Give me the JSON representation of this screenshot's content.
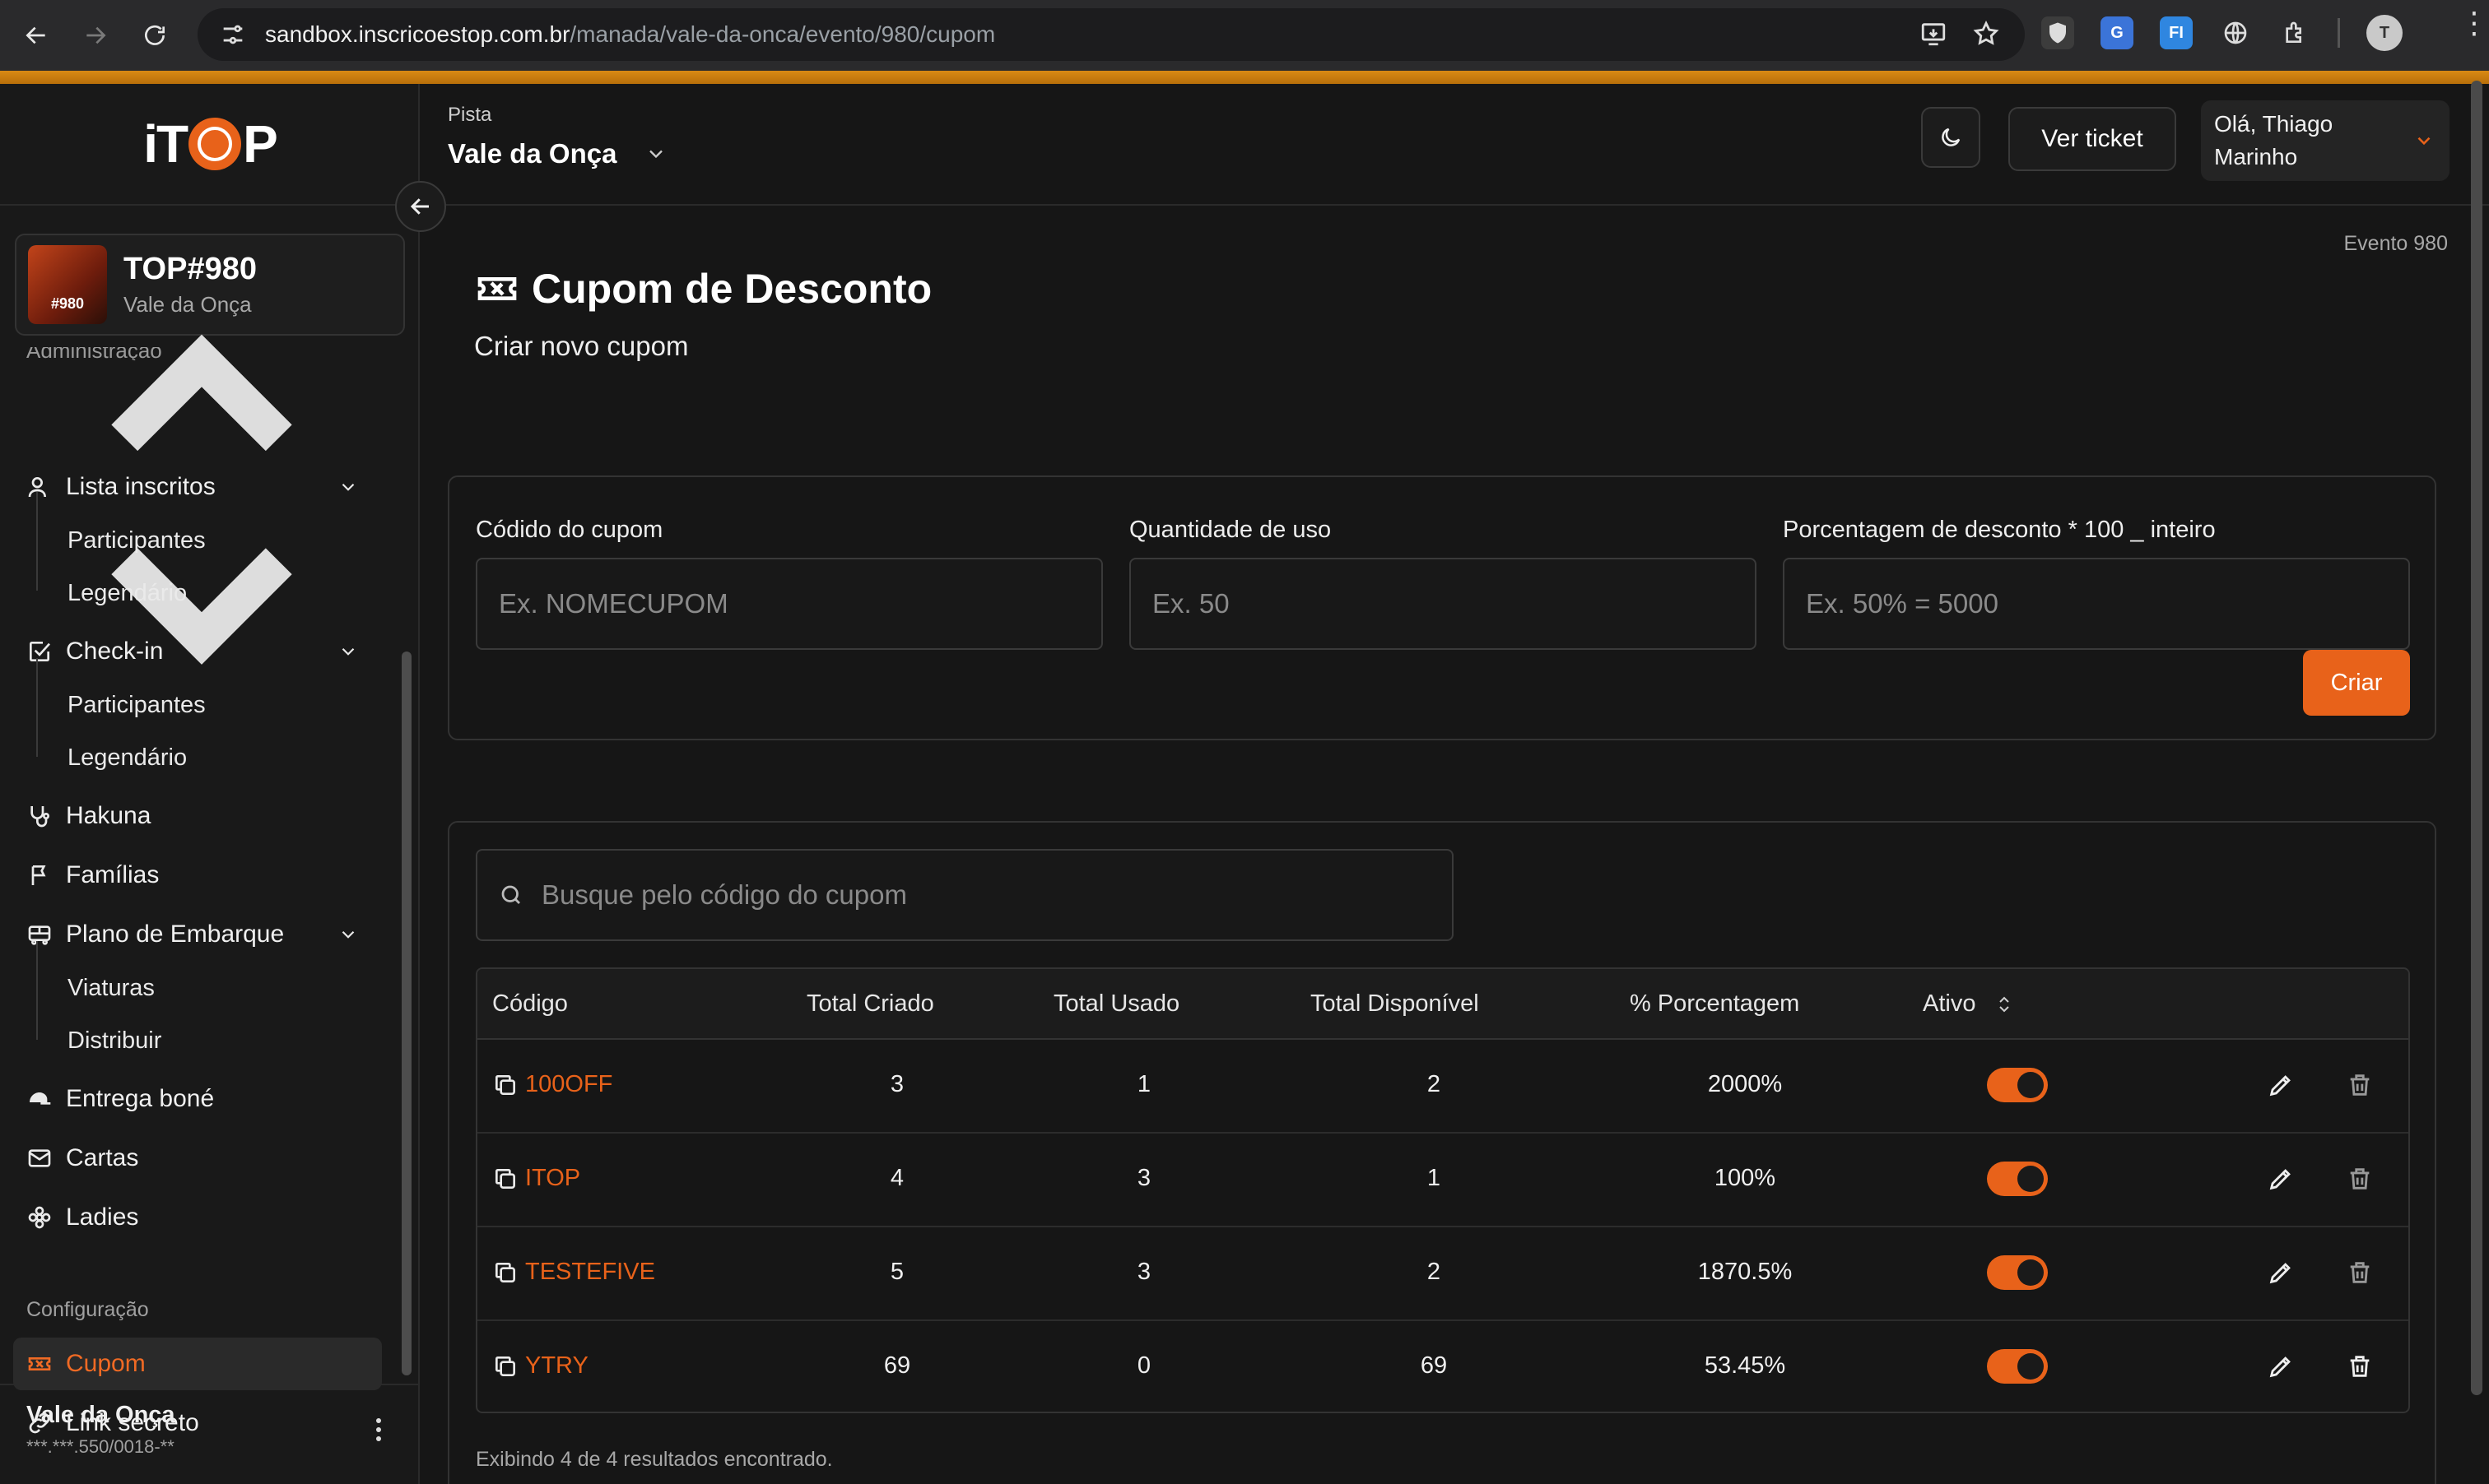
{
  "browser": {
    "url_host": "sandbox.inscricoestop.com.br",
    "url_path": "/manada/vale-da-onca/evento/980/cupom",
    "extensions": [
      "shield-icon",
      "translate-icon",
      "fi-icon",
      "globe-icon",
      "puzzle-icon"
    ],
    "ext_fi_label": "FI"
  },
  "sidebar": {
    "logo_left": "iT",
    "logo_right": "P",
    "event": {
      "title": "TOP#980",
      "subtitle": "Vale da Onça",
      "thumb_label": "#980"
    },
    "section_admin": "Administração",
    "items": [
      {
        "label": "Lista inscritos",
        "icon": "users-icon",
        "sub": [
          "Participantes",
          "Legendário"
        ]
      },
      {
        "label": "Check-in",
        "icon": "checkbox-icon",
        "sub": [
          "Participantes",
          "Legendário"
        ]
      },
      {
        "label": "Hakuna",
        "icon": "stethoscope-icon"
      },
      {
        "label": "Famílias",
        "icon": "flag-icon"
      },
      {
        "label": "Plano de Embarque",
        "icon": "bus-icon",
        "sub": [
          "Viaturas",
          "Distribuir"
        ]
      },
      {
        "label": "Entrega boné",
        "icon": "cap-icon"
      },
      {
        "label": "Cartas",
        "icon": "mail-icon"
      },
      {
        "label": "Ladies",
        "icon": "flower-icon"
      }
    ],
    "section_config": "Configuração",
    "config_items": [
      {
        "label": "Cupom",
        "icon": "ticket-icon",
        "active": true
      },
      {
        "label": "Link secreto",
        "icon": "link-icon"
      }
    ],
    "footer": {
      "name": "Vale da Onça",
      "doc": "***.***.550/0018-**"
    }
  },
  "header": {
    "pista_label": "Pista",
    "pista_value": "Vale da Onça",
    "ticket_button": "Ver ticket",
    "user_greeting": "Olá, Thiago Marinho"
  },
  "page": {
    "event_tag": "Evento 980",
    "title": "Cupom de Desconto",
    "subtitle": "Criar novo cupom"
  },
  "form": {
    "code_label": "Códido do cupom",
    "code_placeholder": "Ex. NOMECUPOM",
    "qty_label": "Quantidade de uso",
    "qty_placeholder": "Ex. 50",
    "pct_label": "Porcentagem de desconto * 100 _ inteiro",
    "pct_placeholder": "Ex. 50% = 5000",
    "create_button": "Criar"
  },
  "search": {
    "placeholder": "Busque pelo código do cupom"
  },
  "table": {
    "headers": {
      "codigo": "Código",
      "total_criado": "Total Criado",
      "total_usado": "Total Usado",
      "total_disponivel": "Total Disponível",
      "porcentagem": "% Porcentagem",
      "ativo": "Ativo"
    },
    "rows": [
      {
        "code": "100OFF",
        "created": "3",
        "used": "1",
        "available": "2",
        "pct": "2000%",
        "active": true
      },
      {
        "code": "ITOP",
        "created": "4",
        "used": "3",
        "available": "1",
        "pct": "100%",
        "active": true
      },
      {
        "code": "TESTEFIVE",
        "created": "5",
        "used": "3",
        "available": "2",
        "pct": "1870.5%",
        "active": true
      },
      {
        "code": "YTRY",
        "created": "69",
        "used": "0",
        "available": "69",
        "pct": "53.45%",
        "active": true
      }
    ],
    "result_info": "Exibindo 4 de 4 resultados encontrado."
  },
  "colors": {
    "accent": "#e8621a",
    "bg": "#161616",
    "top_strip": "#d98a14"
  }
}
